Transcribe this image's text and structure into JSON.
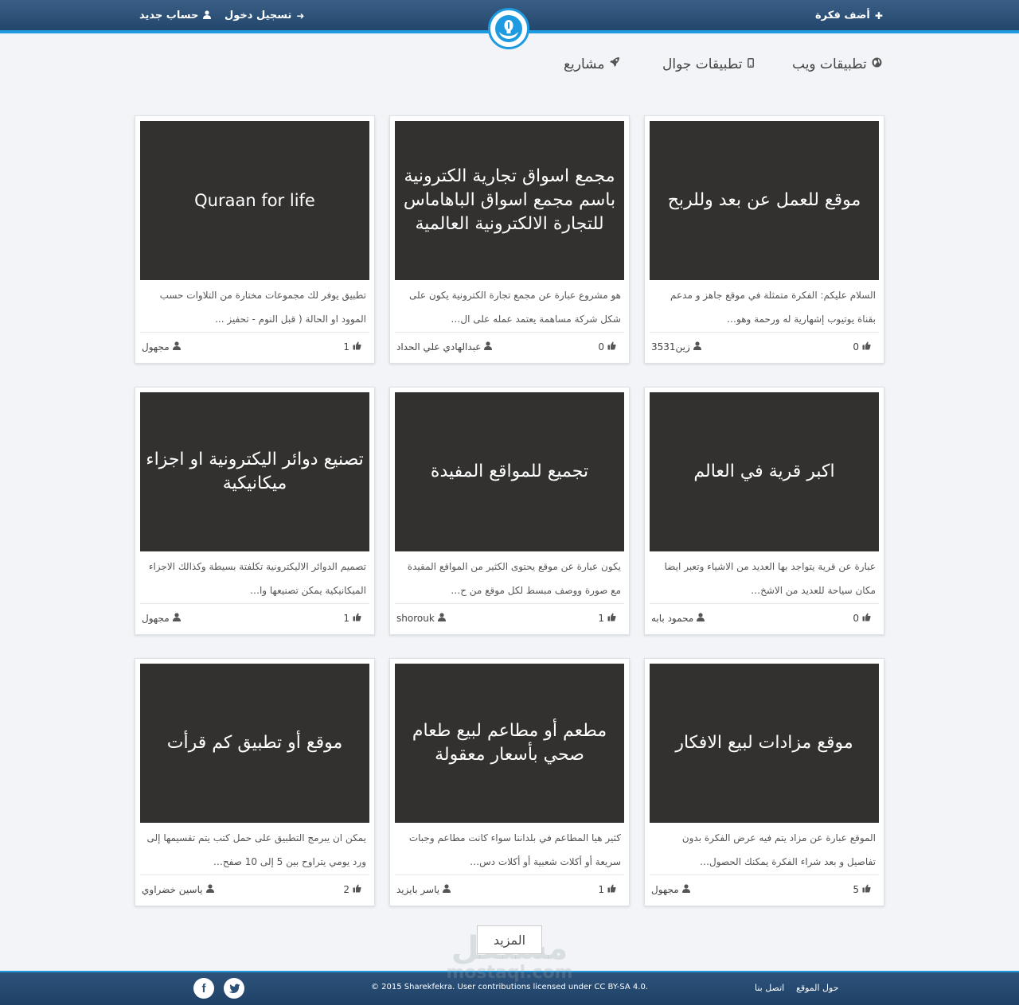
{
  "header": {
    "add_idea": "أضف فكرة",
    "register": "حساب جديد",
    "login": "تسجيل دخول"
  },
  "nav": {
    "web_apps": "تطبيقات ويب",
    "mobile_apps": "تطبيقات جوال",
    "projects": "مشاريع"
  },
  "cards": [
    {
      "title": "موقع للعمل عن بعد وللربح",
      "desc": "السلام عليكم: الفكرة متمثلة في موقع جاهز و مدعم بقناة يوتيوب إشهارية له ورحمة وهو…",
      "author": "زين3531",
      "likes": "0"
    },
    {
      "title": "مجمع اسواق تجارية الكترونية باسم مجمع اسواق الباهاماس للتجارة الالكترونية العالمية",
      "desc": "هو مشروع عبارة عن مجمع تجارة الكترونية يكون على شكل شركة مساهمة يعتمد عمله على ال…",
      "author": "عبدالهادي علي الحداد",
      "likes": "0"
    },
    {
      "title": "Quraan for life",
      "desc": "تطبيق يوفر لك مجموعات مختارة من التلاوات حسب الموود او الحالة ( قبل النوم - تحفيز ...",
      "author": "مجهول",
      "likes": "1"
    },
    {
      "title": "اكبر قرية في العالم",
      "desc": "عبارة عن قرية يتواجد بها العديد من الاشياء وتعبر ايضا مكان سياحة للعديد من الاشخ…",
      "author": "محمود بابه",
      "likes": "0"
    },
    {
      "title": "تجميع للمواقع المفيدة",
      "desc": "يكون عبارة عن موقع يحتوى الكثير من المواقع المفيدة مع صورة ووصف مبسط لكل موقع من ح…",
      "author": "shorouk",
      "likes": "1"
    },
    {
      "title": "تصنيع دوائر اليكترونية او اجزاء ميكانيكية",
      "desc": "تصميم الدوائر الاليكترونية تكلفتة بسيطة وكذالك الاجزاء الميكانيكية يمكن تصنيعها وا…",
      "author": "مجهول",
      "likes": "1"
    },
    {
      "title": "موقع مزادات لبيع الافكار",
      "desc": "الموقع عبارة عن مزاد يتم فيه عرض الفكرة بدون تفاصيل و بعد شراء الفكرة يمكنك الحصول…",
      "author": "مجهول",
      "likes": "5"
    },
    {
      "title": "مطعم أو مطاعم لبيع طعام صحي بأسعار معقولة",
      "desc": "كثير هيا المطاعم في بلداننا سواء كانت مطاعم وجبات سريعة أو أكلات شعبية أو أكلات دس…",
      "author": "ياسر بايزيد",
      "likes": "1"
    },
    {
      "title": "موقع أو تطبيق كم قرأت",
      "desc": "يمكن ان يبرمج التطبيق على حمل كتب يتم تقسيمها إلى ورد يومي يتراوح بين 5 إلى 10 صفح…",
      "author": "ياسين خضراوي",
      "likes": "2"
    }
  ],
  "more_label": "المزيد",
  "watermark": {
    "line1": "مستقل",
    "line2": "mostaql.com"
  },
  "footer": {
    "copyright": "© 2015 Sharekfekra. User contributions licensed under CC BY-SA 4.0.",
    "about": "حول الموقع",
    "contact": "اتصل بنا"
  },
  "icons": {
    "add": "plus-icon",
    "user": "user-icon",
    "login": "sign-in-icon",
    "globe": "globe-icon",
    "mobile": "mobile-icon",
    "rocket": "rocket-icon",
    "thumb": "thumbs-up-icon",
    "facebook": "facebook-icon",
    "twitter": "twitter-icon"
  },
  "colors": {
    "header": "#2b5178",
    "accent": "#1e9be0",
    "thumb_bg": "#323130"
  }
}
